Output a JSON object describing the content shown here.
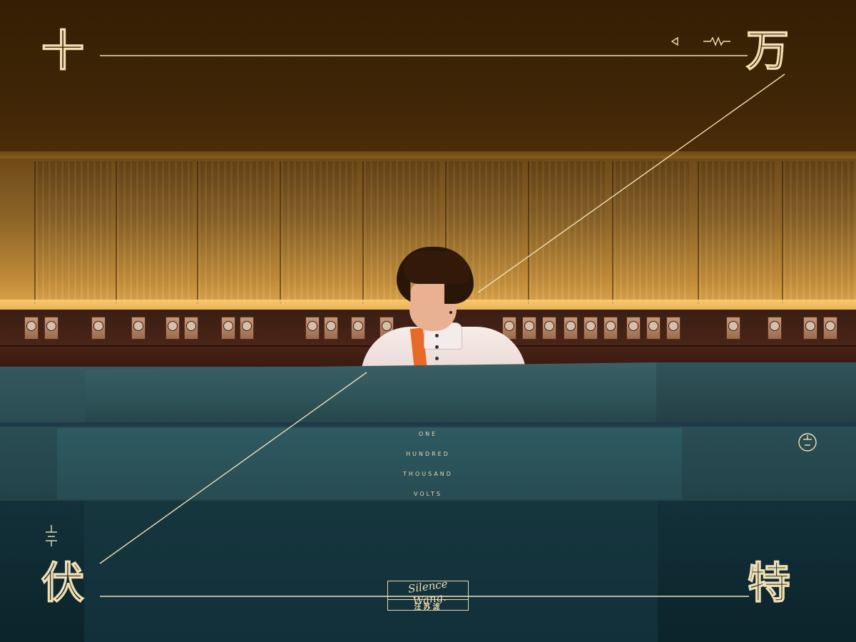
{
  "title_chars": {
    "top_left": "十",
    "top_right": "万",
    "bottom_left": "伏",
    "bottom_right": "特"
  },
  "center_text": [
    "ONE",
    "HUNDRED",
    "THOUSAND",
    "VOLTS"
  ],
  "signature": {
    "script": "Silence Wang.",
    "name": "汪苏泷"
  },
  "colors": {
    "line_accent": "#f2dfb4",
    "ceiling": "#3d2406",
    "desk_teal": "#2e5a62",
    "jacket_strap": "#e86a28"
  },
  "icons": [
    "arrow-left-icon",
    "resistor-icon",
    "battery-icon",
    "plug-icon"
  ]
}
